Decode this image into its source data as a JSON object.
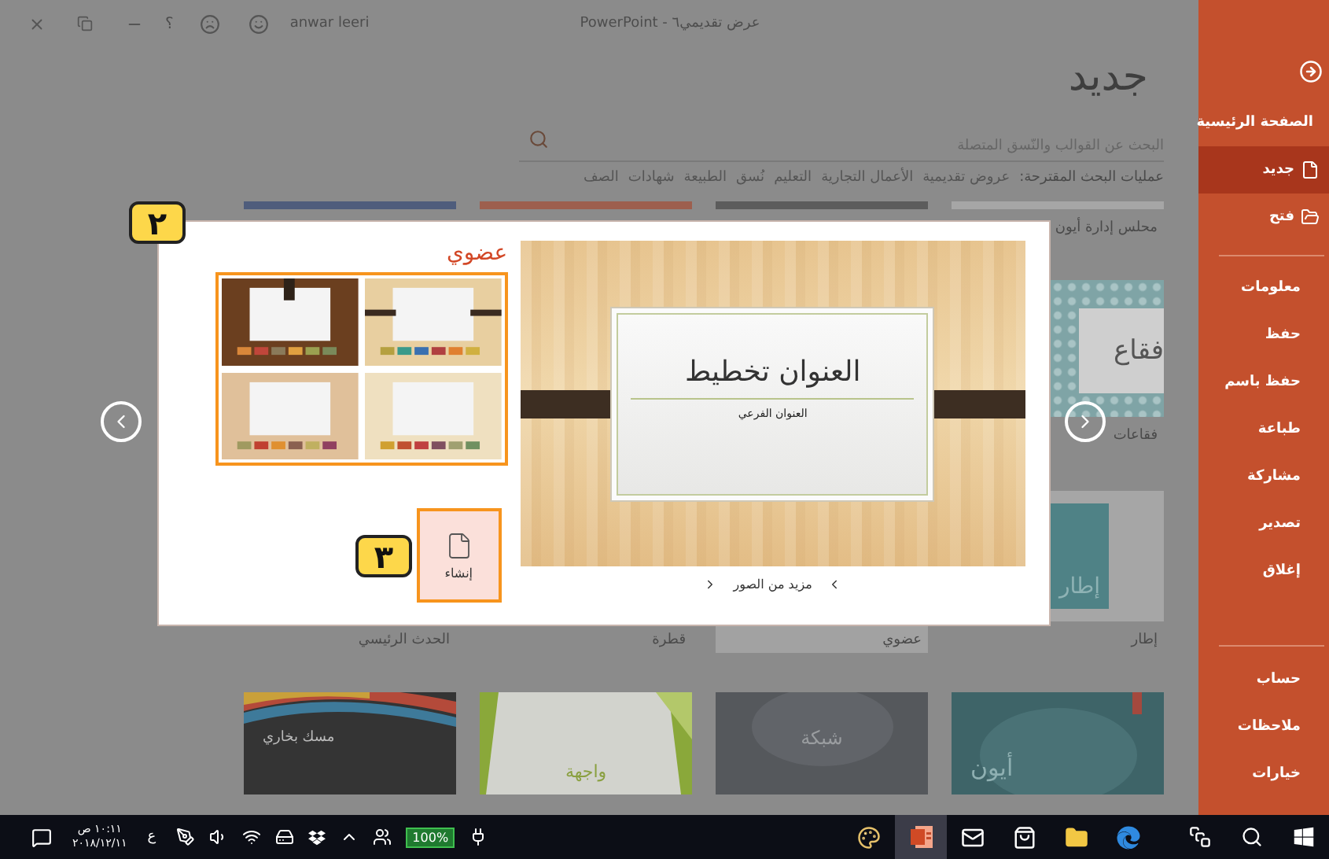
{
  "title_bar": {
    "user": "anwar leeri",
    "help": "؟",
    "title": "عرض تقديمي٦ - PowerPoint"
  },
  "backstage": {
    "heading": "جديد",
    "search": {
      "placeholder": "البحث عن القوالب والنّسق المتصلة"
    },
    "suggested": {
      "label": "عمليات البحث المقترحة:",
      "items": [
        "عروض تقديمية",
        "الأعمال التجارية",
        "التعليم",
        "نُسق",
        "الطبيعة",
        "شهادات",
        "الصف"
      ]
    },
    "gallery": {
      "top_caption": "محلس إدارة أيون",
      "bubbles": {
        "thumb_text": "فقاع",
        "caption": "فقاعات"
      },
      "frame_thumb_text": "إطار",
      "captions": [
        {
          "text": "إطار",
          "selected": false
        },
        {
          "text": "عضوي",
          "selected": true
        },
        {
          "text": "قطرة",
          "selected": false
        },
        {
          "text": "الحدث الرئيسي",
          "selected": false
        }
      ],
      "templates": [
        {
          "kind": "ion",
          "name": "أيون"
        },
        {
          "kind": "mesh",
          "name": "شبكة"
        },
        {
          "kind": "facet",
          "name": "واجهة"
        },
        {
          "kind": "vapor",
          "name": "مسك بخاري"
        }
      ]
    }
  },
  "modal": {
    "title": "عضوي",
    "preview": {
      "title": "العنوان تخطيط",
      "subtitle": "العنوان الفرعي"
    },
    "more_images": "مزيد من الصور",
    "create_button": "إنشاء"
  },
  "callouts": [
    {
      "text": "٢"
    },
    {
      "text": "٣"
    }
  ],
  "sidebar": {
    "top": [
      {
        "kind": "home",
        "label": "الصفحة الرئيسية",
        "selected": false
      },
      {
        "kind": "new",
        "label": "جديد",
        "selected": true
      },
      {
        "kind": "open",
        "label": "فتح",
        "selected": false
      }
    ],
    "middle": [
      "معلومات",
      "حفظ",
      "حفظ باسم",
      "طباعة",
      "مشاركة",
      "تصدير",
      "إغلاق"
    ],
    "bottom": [
      "حساب",
      "ملاحظات",
      "خيارات"
    ]
  },
  "taskbar": {
    "time": "١٠:١١ ص",
    "date": "٢٠١٨/١٢/١١",
    "language": "ع",
    "battery": "100%",
    "apps": [
      {
        "kind": "paint",
        "selected": false
      },
      {
        "kind": "slides",
        "selected": true
      },
      {
        "kind": "mail",
        "selected": false
      },
      {
        "kind": "store",
        "selected": false
      },
      {
        "kind": "files",
        "selected": false
      },
      {
        "kind": "browser",
        "selected": false
      }
    ]
  }
}
